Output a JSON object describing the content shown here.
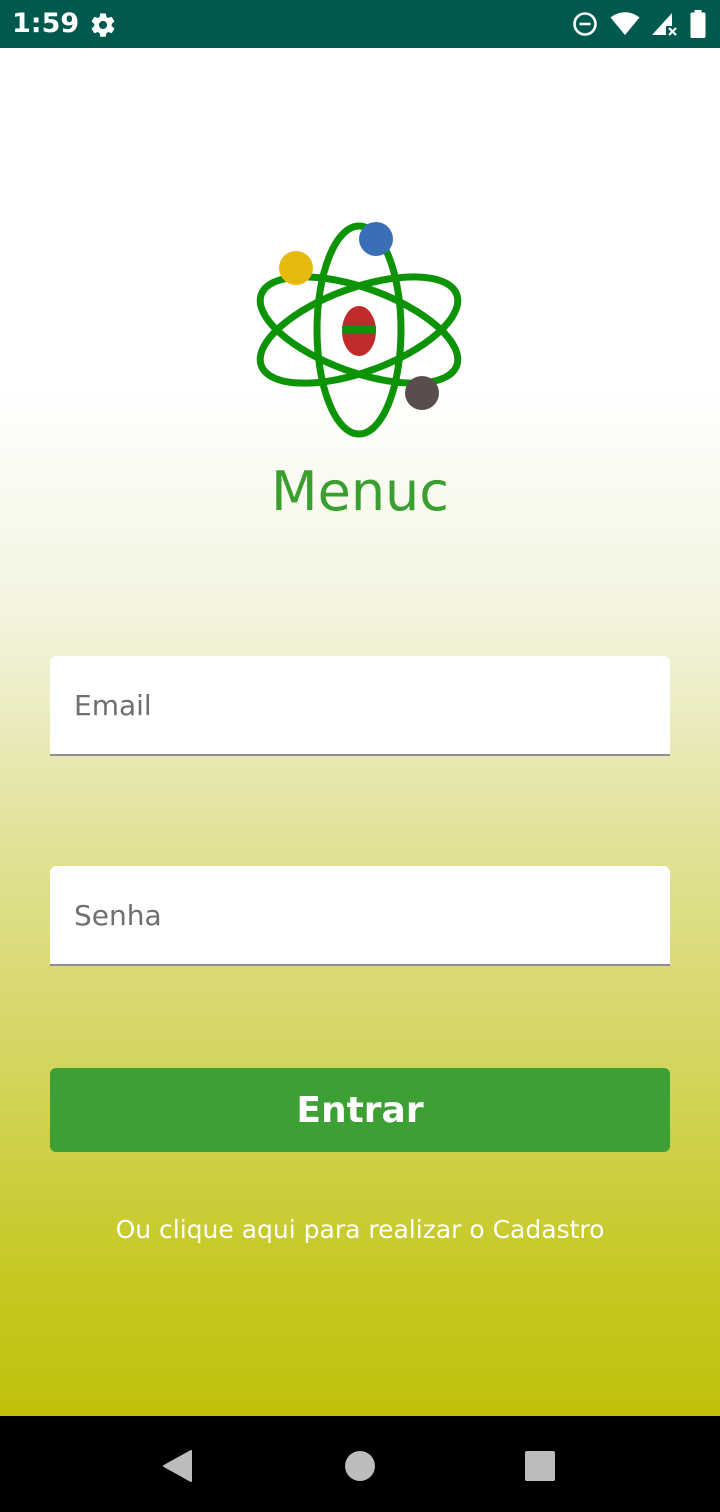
{
  "status_bar": {
    "time": "1:59",
    "background_color": "#00594d",
    "icons": [
      "settings-gear-icon",
      "do-not-disturb-icon",
      "wifi-icon",
      "signal-no-data-icon",
      "battery-icon"
    ]
  },
  "app": {
    "title": "Menuc",
    "logo_icon": "atom-logo-icon",
    "title_color": "#3a9e30"
  },
  "form": {
    "email_placeholder": "Email",
    "email_value": "",
    "password_placeholder": "Senha",
    "password_value": "",
    "login_label": "Entrar",
    "login_color": "#3da035",
    "signup_text": "Ou clique aqui para realizar o Cadastro"
  },
  "nav_bar": {
    "icons": [
      "back-triangle-icon",
      "home-circle-icon",
      "recents-square-icon"
    ]
  }
}
